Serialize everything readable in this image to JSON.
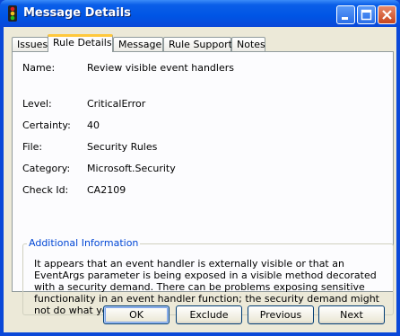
{
  "window": {
    "title": "Message Details"
  },
  "tabs": [
    {
      "label": "Issues"
    },
    {
      "label": "Rule Details"
    },
    {
      "label": "Message"
    },
    {
      "label": "Rule Support"
    },
    {
      "label": "Notes"
    }
  ],
  "details": {
    "name_label": "Name:",
    "name_value": "Review visible event handlers",
    "level_label": "Level:",
    "level_value": "CriticalError",
    "certainty_label": "Certainty:",
    "certainty_value": "40",
    "file_label": "File:",
    "file_value": "Security Rules",
    "category_label": "Category:",
    "category_value": "Microsoft.Security",
    "checkid_label": "Check Id:",
    "checkid_value": "CA2109"
  },
  "additional": {
    "legend": "Additional Information",
    "text": "It appears that an event handler is externally visible or that an EventArgs parameter is being exposed in a visible method decorated with a security demand. There can be problems exposing sensitive functionality in an event handler function; the security demand might not do what you expect."
  },
  "buttons": {
    "ok": "OK",
    "exclude": "Exclude",
    "previous": "Previous",
    "next": "Next"
  },
  "colors": {
    "titlebar": "#0055e5",
    "active_tab_accent": "#ffc83c",
    "legend_text": "#0046d5"
  }
}
